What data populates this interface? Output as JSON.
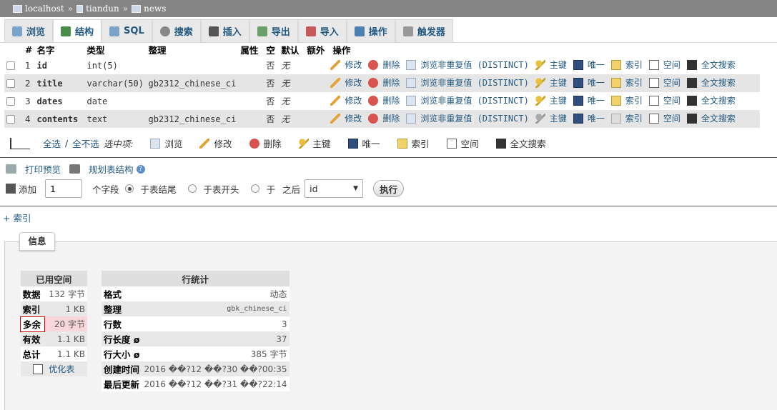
{
  "breadcrumb": {
    "server": "localhost",
    "db": "tiandun",
    "table": "news",
    "separator": "»"
  },
  "tabs": [
    {
      "label": "浏览",
      "icon": "browse-icon"
    },
    {
      "label": "结构",
      "icon": "structure-icon"
    },
    {
      "label": "SQL",
      "icon": "sql-icon"
    },
    {
      "label": "搜索",
      "icon": "search-icon"
    },
    {
      "label": "插入",
      "icon": "insert-icon"
    },
    {
      "label": "导出",
      "icon": "export-icon"
    },
    {
      "label": "导入",
      "icon": "import-icon"
    },
    {
      "label": "操作",
      "icon": "operations-icon"
    },
    {
      "label": "触发器",
      "icon": "triggers-icon"
    }
  ],
  "structure": {
    "headers": {
      "num": "#",
      "name": "名字",
      "type": "类型",
      "collation": "整理",
      "attributes": "属性",
      "null": "空",
      "default": "默认",
      "extra": "额外",
      "action": "操作"
    },
    "actions": {
      "change": "修改",
      "drop": "删除",
      "distinct": "浏览非重复值 (DISTINCT)",
      "primary": "主键",
      "unique": "唯一",
      "index": "索引",
      "spatial": "空间",
      "fulltext": "全文搜索"
    },
    "rows": [
      {
        "num": "1",
        "name": "id",
        "type": "int(5)",
        "collation": "",
        "null": "否",
        "default": "无"
      },
      {
        "num": "2",
        "name": "title",
        "type": "varchar(50)",
        "collation": "gb2312_chinese_ci",
        "null": "否",
        "default": "无"
      },
      {
        "num": "3",
        "name": "dates",
        "type": "date",
        "collation": "",
        "null": "否",
        "default": "无"
      },
      {
        "num": "4",
        "name": "contents",
        "type": "text",
        "collation": "gb2312_chinese_ci",
        "null": "否",
        "default": "无"
      }
    ]
  },
  "with_selected": {
    "check_all": "全选",
    "slash": "/",
    "uncheck_all": "全不选",
    "label": "选中项:",
    "browse": "浏览",
    "change": "修改",
    "drop": "删除",
    "primary": "主键",
    "unique": "唯一",
    "index": "索引",
    "spatial": "空间",
    "fulltext": "全文搜索"
  },
  "print_view": "打印预览",
  "propose_structure": "规划表结构",
  "add": {
    "label": "添加",
    "count": "1",
    "fields": "个字段",
    "at_end": "于表结尾",
    "at_beginning": "于表开头",
    "after_prefix": "于",
    "after": "之后",
    "after_field": "id",
    "go": "执行"
  },
  "indexes_link": "+ 索引",
  "info_tab": "信息",
  "space_usage": {
    "title": "已用空间",
    "rows": [
      {
        "k": "数据",
        "v": "132 字节"
      },
      {
        "k": "索引",
        "v": "1 KB"
      },
      {
        "k": "多余",
        "v": "20 字节"
      },
      {
        "k": "有效",
        "v": "1.1 KB"
      },
      {
        "k": "总计",
        "v": "1.1 KB"
      }
    ],
    "optimize": "优化表"
  },
  "row_stats": {
    "title": "行统计",
    "rows": [
      {
        "k": "格式",
        "v": "动态"
      },
      {
        "k": "整理",
        "v": "gbk_chinese_ci"
      },
      {
        "k": "行数",
        "v": "3"
      },
      {
        "k": "行长度 ø",
        "v": "37"
      },
      {
        "k": "行大小 ø",
        "v": "385 字节"
      },
      {
        "k": "创建时间",
        "v": "2016 ��?12 ��?30 ��?00:35"
      },
      {
        "k": "最后更新",
        "v": "2016 ��?12 ��?31 ��?22:14"
      }
    ]
  }
}
